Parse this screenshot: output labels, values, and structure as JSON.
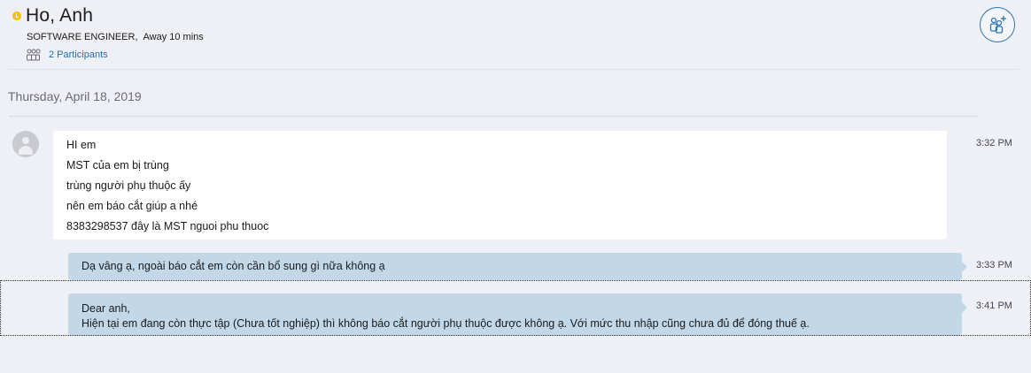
{
  "header": {
    "contact_name": "Ho, Anh",
    "job_title": "SOFTWARE ENGINEER",
    "separator": ",",
    "presence": "Away 10 mins",
    "participants_label": "2 Participants",
    "status_color": "#f2c200"
  },
  "conversation": {
    "date": "Thursday, April 18, 2019",
    "incoming": {
      "lines": [
        "HI em",
        "MST của em bị trùng",
        "trùng người phụ thuộc ấy",
        "nên em báo cắt giúp a nhé",
        "8383298537 đây là MST nguoi phu thuoc"
      ],
      "time": "3:32 PM"
    },
    "outgoing": [
      {
        "lines": [
          "Dạ vâng ạ, ngoài báo cắt em còn cần bổ sung gì nữa không ạ"
        ],
        "time": "3:33 PM"
      },
      {
        "lines": [
          "Dear anh,",
          "Hiện tại em đang còn thực tập (Chưa tốt nghiệp) thì không báo cắt người phụ thuộc được không ạ. Với mức thu nhập cũng chưa đủ để đóng thuế ạ."
        ],
        "time": "3:41 PM"
      }
    ]
  },
  "icons": {
    "status": "away-clock-icon",
    "participants": "participants-icon",
    "add_people": "add-people-icon",
    "avatar": "default-avatar-icon"
  },
  "colors": {
    "background": "#eff0f5",
    "incoming_bubble": "#ffffff",
    "outgoing_bubble": "#c2d8e8",
    "link": "#1f6fa8",
    "accent_ring": "#2a77b0"
  }
}
